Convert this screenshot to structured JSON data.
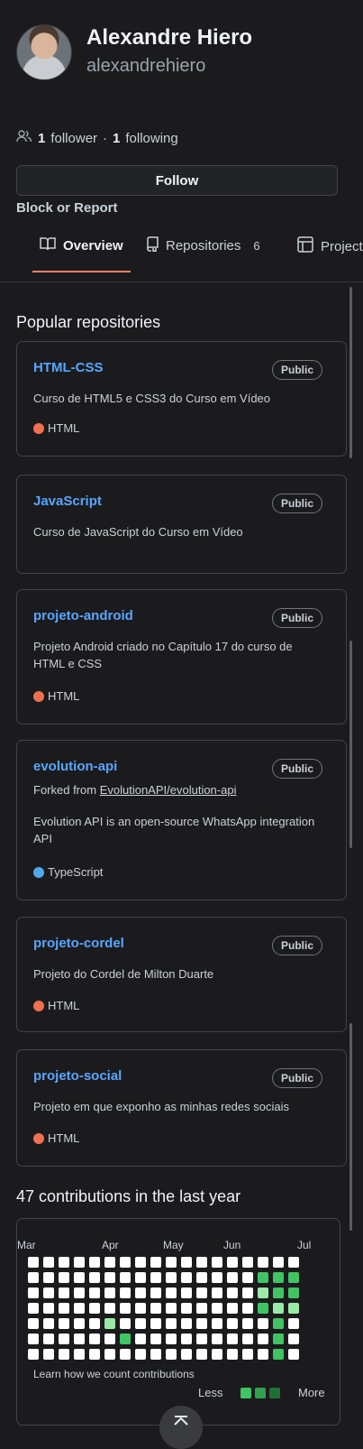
{
  "profile": {
    "name": "Alexandre Hiero",
    "login": "alexandrehiero",
    "followers_count": "1",
    "followers_label": "follower",
    "separator": "·",
    "following_count": "1",
    "following_label": "following",
    "follow_button": "Follow",
    "block_report": "Block or Report"
  },
  "tabs": [
    {
      "label": "Overview",
      "icon": "book-icon",
      "active": true
    },
    {
      "label": "Repositories",
      "icon": "repo-icon",
      "count": "6"
    },
    {
      "label": "Projects",
      "icon": "table-icon"
    }
  ],
  "popular": {
    "title": "Popular repositories",
    "repos": [
      {
        "name": "HTML-CSS",
        "visibility": "Public",
        "description": "Curso de HTML5 e CSS3 do Curso em Vídeo",
        "language": "HTML",
        "language_color": "#f1704f"
      },
      {
        "name": "JavaScript",
        "visibility": "Public",
        "description": "Curso de JavaScript do Curso em Vídeo"
      },
      {
        "name": "projeto-android",
        "visibility": "Public",
        "description": "Projeto Android criado no Capítulo 17 do curso de HTML e CSS",
        "language": "HTML",
        "language_color": "#f1704f"
      },
      {
        "name": "evolution-api",
        "visibility": "Public",
        "forked_prefix": "Forked from",
        "forked_from": "EvolutionAPI/evolution-api",
        "description": "Evolution API is an open-source WhatsApp integration API",
        "language": "TypeScript",
        "language_color": "#4fa8f0"
      },
      {
        "name": "projeto-cordel",
        "visibility": "Public",
        "description": "Projeto do Cordel de Milton Duarte",
        "language": "HTML",
        "language_color": "#f1704f"
      },
      {
        "name": "projeto-social",
        "visibility": "Public",
        "description": "Projeto em que exponho as minhas redes sociais",
        "language": "HTML",
        "language_color": "#f1704f"
      }
    ]
  },
  "contributions": {
    "title": "47 contributions in the last year",
    "months": [
      "Mar",
      "Apr",
      "May",
      "Jun",
      "Jul"
    ],
    "learn": "Learn how we count contributions",
    "legend_less": "Less",
    "legend_more": "More",
    "colors": {
      "empty": "#ffffff",
      "l1": "#9be9a8",
      "l2": "#40c463",
      "l3": "#30a14e",
      "l4": "#216e39"
    },
    "levels": [
      [
        0,
        0,
        0,
        0,
        0,
        0,
        0,
        0,
        0,
        0,
        0,
        0,
        0,
        0,
        0,
        0,
        0,
        0
      ],
      [
        0,
        0,
        0,
        0,
        0,
        0,
        0,
        0,
        0,
        0,
        0,
        0,
        0,
        0,
        0,
        2,
        2,
        2
      ],
      [
        0,
        0,
        0,
        0,
        0,
        0,
        0,
        0,
        0,
        0,
        0,
        0,
        0,
        0,
        0,
        1,
        2,
        2
      ],
      [
        0,
        0,
        0,
        0,
        0,
        0,
        0,
        0,
        0,
        0,
        0,
        0,
        0,
        0,
        0,
        2,
        1,
        1
      ],
      [
        0,
        0,
        0,
        0,
        0,
        1,
        0,
        0,
        0,
        0,
        0,
        0,
        0,
        0,
        0,
        0,
        2,
        0
      ],
      [
        0,
        0,
        0,
        0,
        0,
        0,
        2,
        0,
        0,
        0,
        0,
        0,
        0,
        0,
        0,
        0,
        2,
        0
      ],
      [
        0,
        0,
        0,
        0,
        0,
        0,
        0,
        0,
        0,
        0,
        0,
        0,
        0,
        0,
        0,
        0,
        2,
        0
      ]
    ],
    "legend_levels": [
      "l2",
      "l3",
      "l4"
    ]
  }
}
